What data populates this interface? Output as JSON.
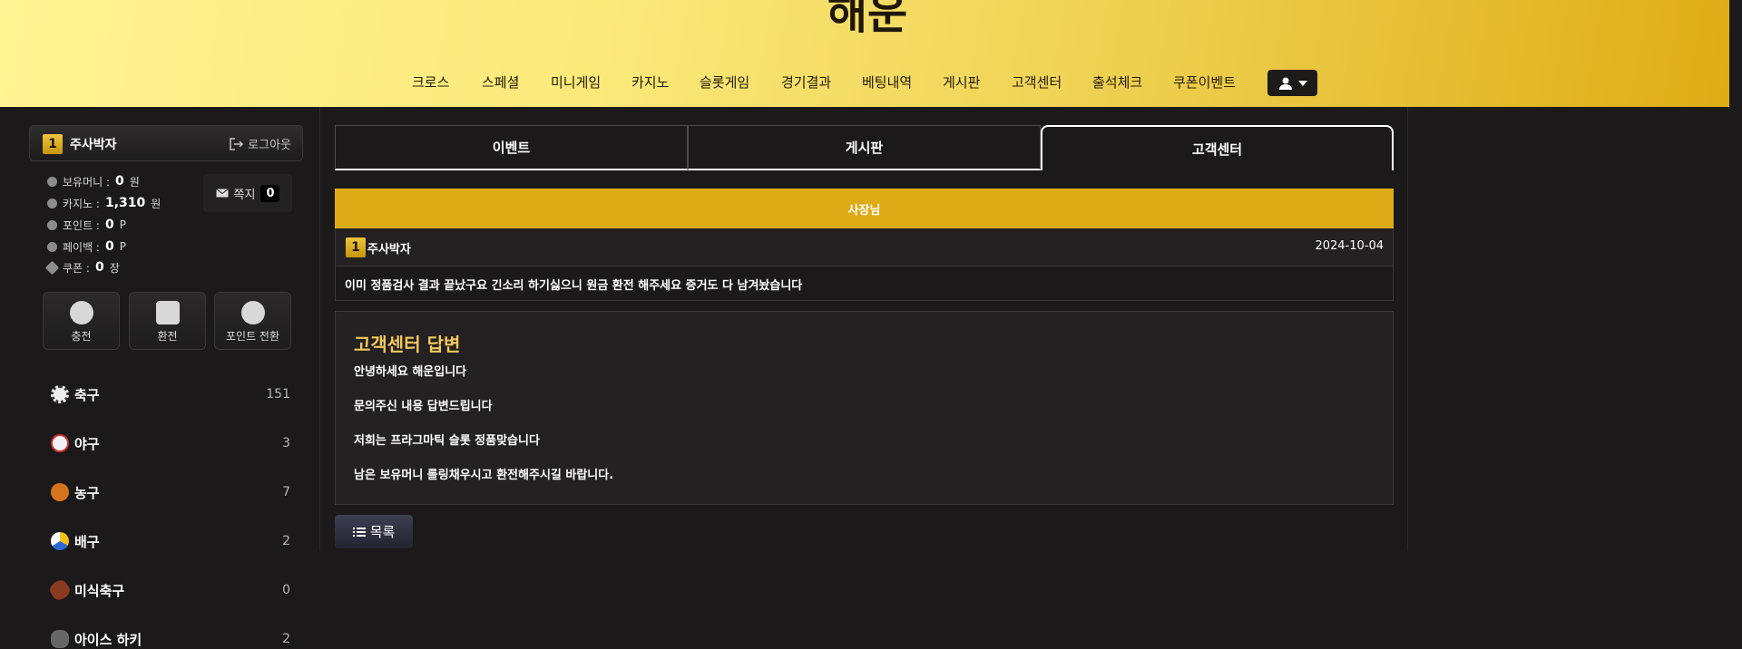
{
  "header": {
    "logo": "해운",
    "nav": [
      "크로스",
      "스페셜",
      "미니게임",
      "카지노",
      "슬롯게임",
      "경기결과",
      "베팅내역",
      "게시판",
      "고객센터",
      "출석체크",
      "쿠폰이벤트"
    ]
  },
  "user": {
    "level": "1",
    "name": "주사박자",
    "logout_label": "로그아웃",
    "stats": [
      {
        "label": "보유머니 :",
        "value": "0",
        "unit": "원"
      },
      {
        "label": "카지노 :",
        "value": "1,310",
        "unit": "원"
      },
      {
        "label": "포인트 :",
        "value": "0",
        "unit": "P"
      },
      {
        "label": "페이백 :",
        "value": "0",
        "unit": "P"
      },
      {
        "label": "쿠폰 :",
        "value": "0",
        "unit": "장"
      }
    ],
    "mail_label": "쪽지",
    "mail_count": "0"
  },
  "actions": [
    "충전",
    "환전",
    "포인트 전환"
  ],
  "sports": [
    {
      "name": "축구",
      "count": "151"
    },
    {
      "name": "야구",
      "count": "3"
    },
    {
      "name": "농구",
      "count": "7"
    },
    {
      "name": "배구",
      "count": "2"
    },
    {
      "name": "미식축구",
      "count": "0"
    },
    {
      "name": "아이스 하키",
      "count": "2"
    }
  ],
  "tabs": [
    "이벤트",
    "게시판",
    "고객센터"
  ],
  "post": {
    "title": "사장님",
    "author_level": "1",
    "author": "주사박자",
    "date": "2024-10-04",
    "body": "이미 정품검사 결과 끝났구요 긴소리 하기싫으니 원금 환전 해주세요 증거도 다 남겨놨습니다"
  },
  "reply": {
    "title": "고객센터 답변",
    "lines": [
      "안녕하세요 해운입니다",
      "문의주신 내용 답변드립니다",
      "저희는 프라그마틱 슬롯 정품맞습니다",
      "남은 보유머니 롤링채우시고 환전해주시길 바랍니다."
    ]
  },
  "list_button": "목록",
  "colors": {
    "accent": "#deab17",
    "reply_title": "#f3c95a",
    "background": "#1b1919"
  }
}
